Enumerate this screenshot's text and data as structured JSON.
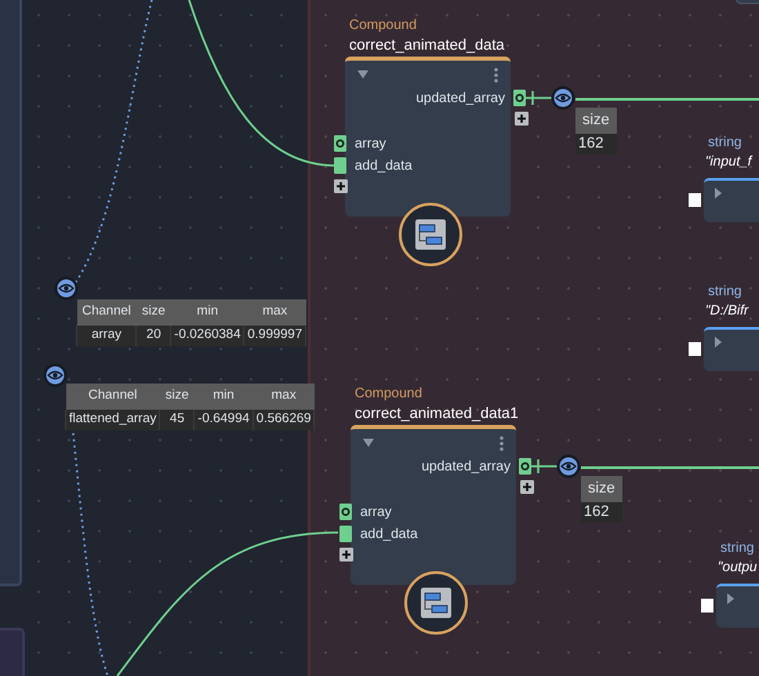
{
  "compounds": [
    {
      "category": "Compound",
      "title": "correct_animated_data",
      "outputs": [
        {
          "name": "updated_array",
          "kind": "array"
        }
      ],
      "inputs": [
        {
          "name": "array",
          "kind": "array"
        },
        {
          "name": "add_data",
          "kind": "plain"
        }
      ],
      "watch": {
        "header": "size",
        "value": "162"
      }
    },
    {
      "category": "Compound",
      "title": "correct_animated_data1",
      "outputs": [
        {
          "name": "updated_array",
          "kind": "array"
        }
      ],
      "inputs": [
        {
          "name": "array",
          "kind": "array"
        },
        {
          "name": "add_data",
          "kind": "plain"
        }
      ],
      "watch": {
        "header": "size",
        "value": "162"
      }
    }
  ],
  "channel_tables": [
    {
      "columns": [
        "Channel",
        "size",
        "min",
        "max"
      ],
      "rows": [
        [
          "array",
          "20",
          "-0.0260384",
          "0.999997"
        ]
      ]
    },
    {
      "columns": [
        "Channel",
        "size",
        "min",
        "max"
      ],
      "rows": [
        [
          "flattened_array",
          "45",
          "-0.64994",
          "0.566269"
        ]
      ]
    }
  ],
  "string_nodes": [
    {
      "type_label": "string",
      "value": "\"input_f"
    },
    {
      "type_label": "string",
      "value": "\"D:/Bifr"
    },
    {
      "type_label": "string",
      "value": "\"outpu"
    }
  ]
}
